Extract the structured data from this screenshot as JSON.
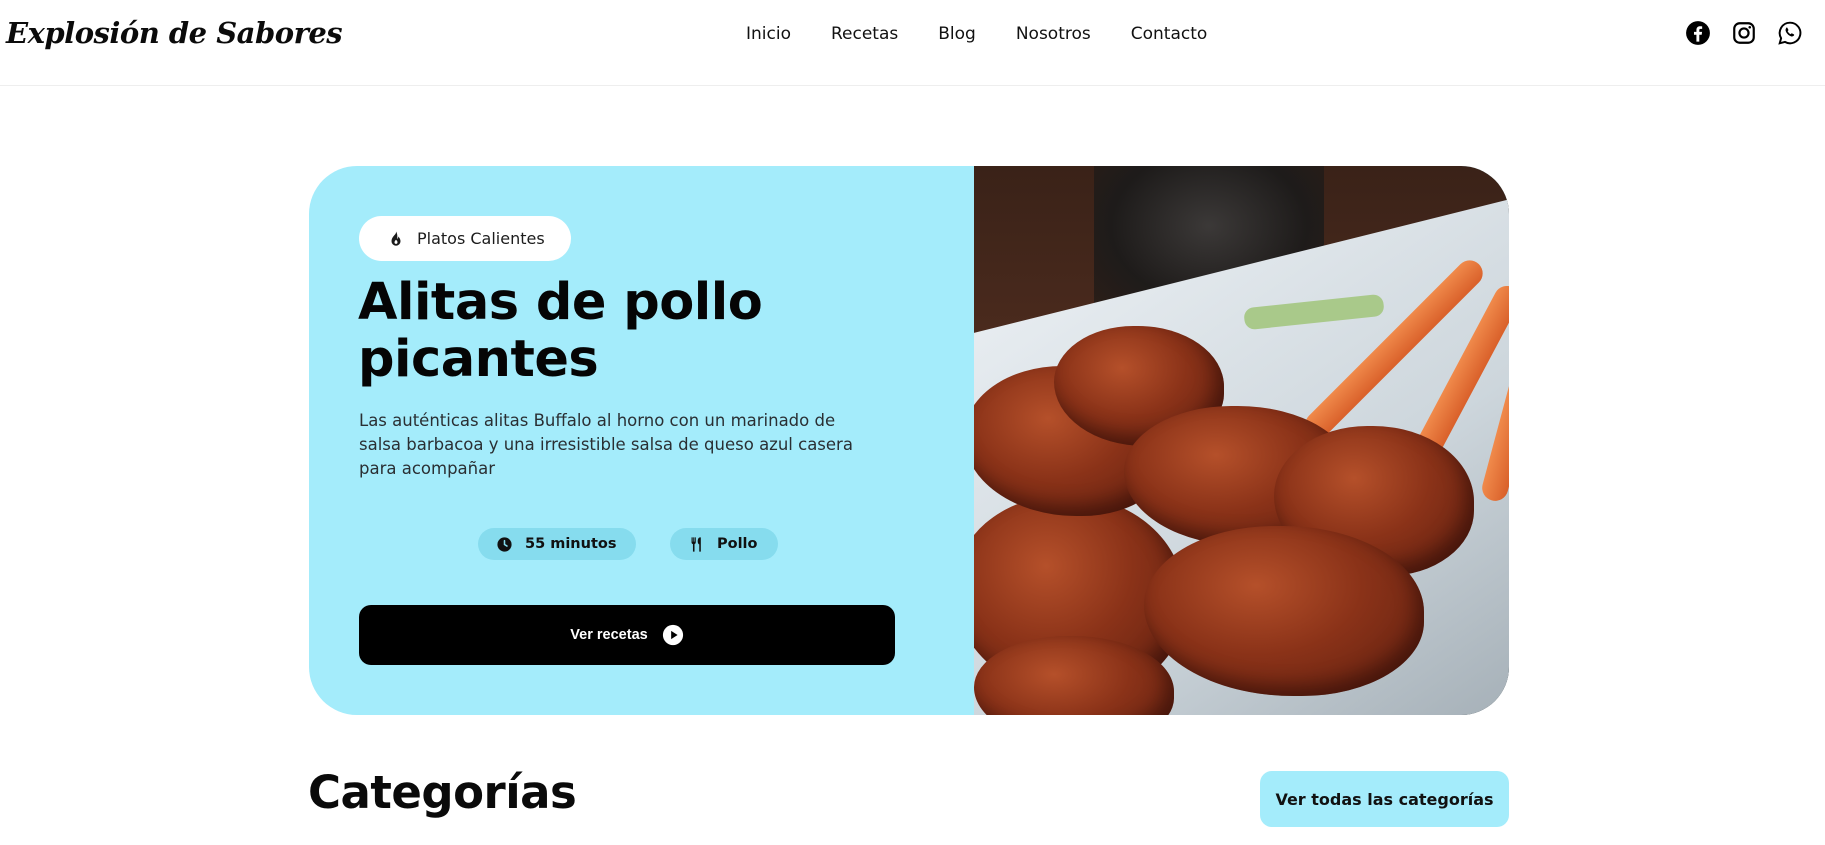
{
  "brand": {
    "name": "Explosión de Sabores"
  },
  "nav": {
    "items": [
      {
        "label": "Inicio"
      },
      {
        "label": "Recetas"
      },
      {
        "label": "Blog"
      },
      {
        "label": "Nosotros"
      },
      {
        "label": "Contacto"
      }
    ]
  },
  "social": {
    "icons": [
      "facebook-icon",
      "instagram-icon",
      "whatsapp-icon"
    ]
  },
  "hero": {
    "badge": {
      "icon": "fire-icon",
      "label": "Platos Calientes"
    },
    "title": "Alitas de pollo picantes",
    "description": "Las auténticas alitas Buffalo al horno con un marinado de salsa barbacoa y una irresistible salsa de queso azul casera para acompañar",
    "time": {
      "icon": "clock-icon",
      "label": "55 minutos"
    },
    "category": {
      "icon": "utensils-icon",
      "label": "Pollo"
    },
    "cta": {
      "label": "Ver recetas",
      "icon": "play-circle-icon"
    },
    "colors": {
      "card_bg": "#a4ecfb",
      "chip_bg": "#86dcee",
      "cta_bg": "#000000"
    }
  },
  "categories": {
    "title": "Categorías",
    "view_all_label": "Ver todas las categorías"
  }
}
